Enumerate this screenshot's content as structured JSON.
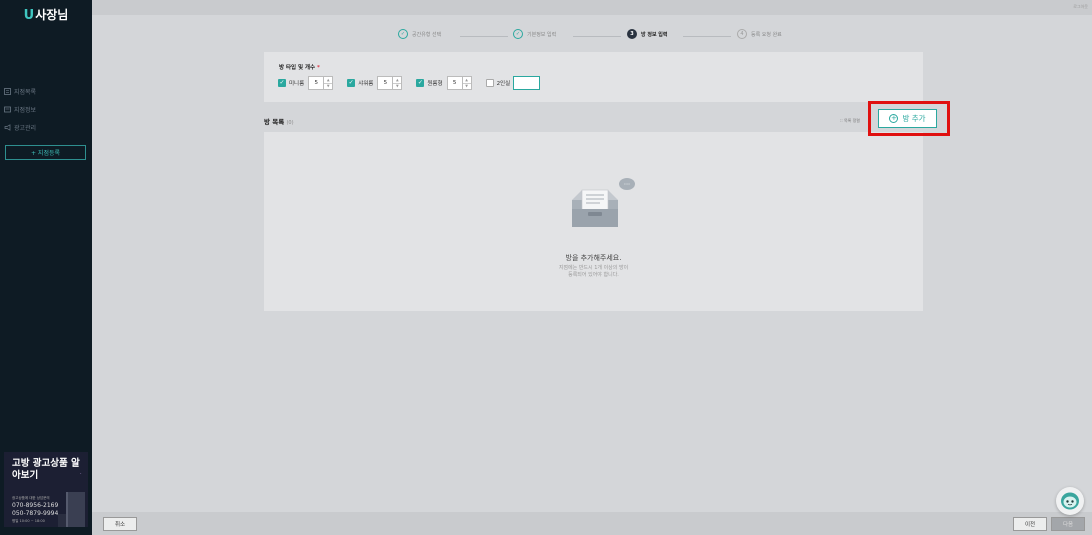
{
  "app": {
    "logo_mark": "U",
    "logo_text": "사장님"
  },
  "sidebar": {
    "items": [
      {
        "label": "지점목록",
        "icon": "list-icon"
      },
      {
        "label": "지점정보",
        "icon": "info-icon"
      },
      {
        "label": "광고관리",
        "icon": "megaphone-icon"
      }
    ],
    "add_branch_label": "+ 지점등록"
  },
  "promo": {
    "title": "고방 광고상품 알아보기",
    "small_text": "광고상품에 대한 상담문의",
    "phone1": "070-8956-2169",
    "phone2": "050-7879-9994",
    "footnote": "평일 10:00 ~ 18:00"
  },
  "topbar": {
    "link_label": "로그아웃"
  },
  "stepper": {
    "steps": [
      {
        "label": "공간유형 선택",
        "state": "done",
        "marker": "✓"
      },
      {
        "label": "기본정보 입력",
        "state": "done",
        "marker": "✓"
      },
      {
        "label": "방 정보 입력",
        "state": "active",
        "marker": "3"
      },
      {
        "label": "등록 요청 완료",
        "state": "todo",
        "marker": "4"
      }
    ]
  },
  "room_types": {
    "label": "방 타입 및 개수",
    "required_mark": "*",
    "items": [
      {
        "label": "미니룸",
        "checked": true,
        "value": "5"
      },
      {
        "label": "샤워룸",
        "checked": true,
        "value": "5"
      },
      {
        "label": "원룸형",
        "checked": true,
        "value": "5"
      },
      {
        "label": "2인실",
        "checked": false,
        "value": ""
      }
    ]
  },
  "room_list": {
    "title": "방 목록",
    "count": "(0)",
    "sort_label": "목록 정렬",
    "add_button_label": "방 추가",
    "empty_title": "방을 추가해주세요.",
    "empty_sub1": "지점에는 반드시 1개 이상의 방이",
    "empty_sub2": "등록되어 있어야 합니다."
  },
  "footer": {
    "cancel_label": "취소",
    "prev_label": "이전",
    "next_label": "다음"
  },
  "colors": {
    "accent": "#2aa89f",
    "highlight": "#e01010",
    "sidebar_bg": "#0e1b24"
  }
}
